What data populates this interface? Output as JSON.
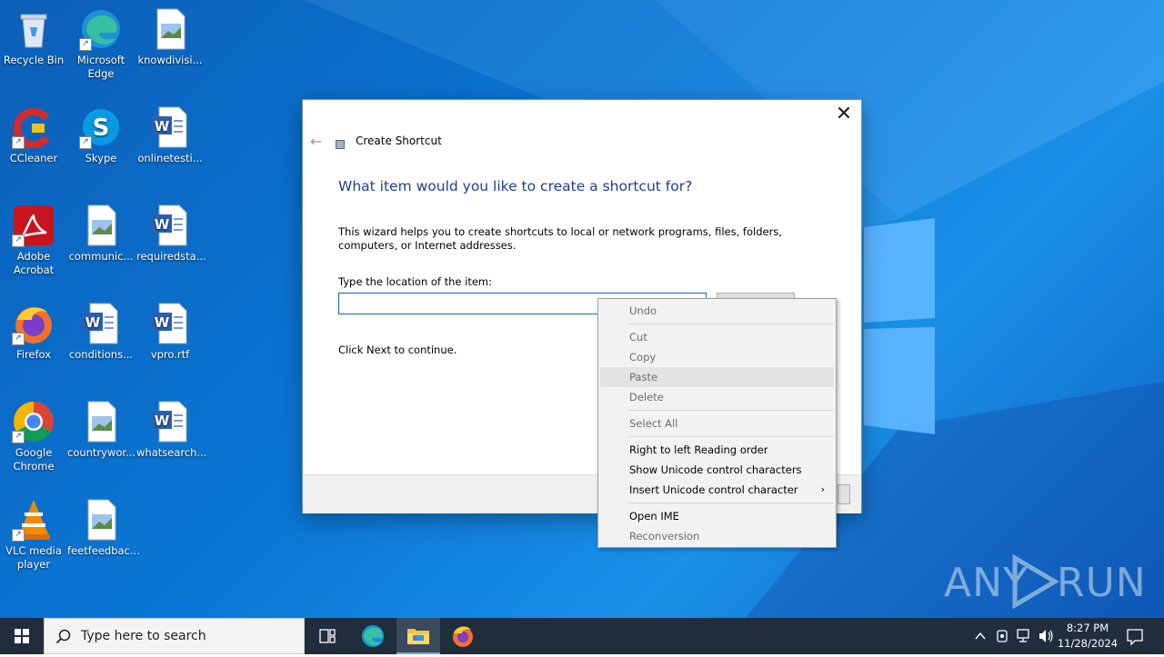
{
  "desktop": {
    "icons": [
      {
        "label": "Recycle Bin",
        "icon": "recycle-bin-icon"
      },
      {
        "label": "Microsoft Edge",
        "icon": "edge-icon"
      },
      {
        "label": "knowdivisi...",
        "icon": "image-file-icon"
      },
      {
        "label": "CCleaner",
        "icon": "ccleaner-icon"
      },
      {
        "label": "Skype",
        "icon": "skype-icon"
      },
      {
        "label": "onlinetesti...",
        "icon": "word-doc-icon"
      },
      {
        "label": "Adobe Acrobat",
        "icon": "acrobat-icon"
      },
      {
        "label": "communic...",
        "icon": "image-file-icon"
      },
      {
        "label": "requiredsta...",
        "icon": "word-doc-icon"
      },
      {
        "label": "Firefox",
        "icon": "firefox-icon"
      },
      {
        "label": "conditions...",
        "icon": "word-doc-icon"
      },
      {
        "label": "vpro.rtf",
        "icon": "word-doc-icon"
      },
      {
        "label": "Google Chrome",
        "icon": "chrome-icon"
      },
      {
        "label": "countrywor...",
        "icon": "image-file-icon"
      },
      {
        "label": "whatsearch...",
        "icon": "word-doc-icon"
      },
      {
        "label": "VLC media player",
        "icon": "vlc-icon"
      },
      {
        "label": "feetfeedbac...",
        "icon": "image-file-icon"
      }
    ]
  },
  "dialog": {
    "title": "Create Shortcut",
    "heading": "What item would you like to create a shortcut for?",
    "description": "This wizard helps you to create shortcuts to local or network programs, files, folders, computers, or Internet addresses.",
    "location_label": "Type the location of the item:",
    "location_value": "",
    "hint": "Click Next to continue.",
    "close_glyph": "✕",
    "back_glyph": "←"
  },
  "context_menu": {
    "items": [
      {
        "label": "Undo",
        "enabled": false
      },
      {
        "label": "Cut",
        "enabled": false
      },
      {
        "label": "Copy",
        "enabled": false
      },
      {
        "label": "Paste",
        "enabled": false,
        "highlighted": true
      },
      {
        "label": "Delete",
        "enabled": false
      },
      {
        "label": "Select All",
        "enabled": false
      },
      {
        "label": "Right to left Reading order",
        "enabled": true
      },
      {
        "label": "Show Unicode control characters",
        "enabled": true
      },
      {
        "label": "Insert Unicode control character",
        "enabled": true,
        "submenu": true
      },
      {
        "label": "Open IME",
        "enabled": true
      },
      {
        "label": "Reconversion",
        "enabled": false
      }
    ],
    "submenu_glyph": "›"
  },
  "watermark": {
    "text_left": "ANY",
    "text_right": "RUN"
  },
  "taskbar": {
    "search_placeholder": "Type here to search",
    "time": "8:27 PM",
    "date": "11/28/2024"
  }
}
